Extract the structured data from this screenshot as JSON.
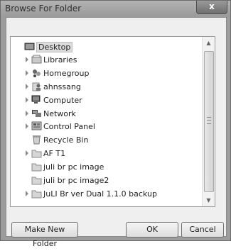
{
  "window": {
    "title": "Browse For Folder",
    "close_glyph": "x"
  },
  "tree": {
    "items": [
      {
        "label": "Desktop",
        "icon": "desktop-icon",
        "selected": true,
        "expander": false
      },
      {
        "label": "Libraries",
        "icon": "libraries-icon",
        "expander": true
      },
      {
        "label": "Homegroup",
        "icon": "homegroup-icon",
        "expander": true
      },
      {
        "label": "ahnssang",
        "icon": "user-folder-icon",
        "expander": true
      },
      {
        "label": "Computer",
        "icon": "computer-icon",
        "expander": true
      },
      {
        "label": "Network",
        "icon": "network-icon",
        "expander": true
      },
      {
        "label": "Control Panel",
        "icon": "control-panel-icon",
        "expander": true
      },
      {
        "label": "Recycle Bin",
        "icon": "recycle-bin-icon",
        "expander": false
      },
      {
        "label": "AF T1",
        "icon": "folder-icon",
        "expander": true
      },
      {
        "label": "juli br pc image",
        "icon": "folder-icon",
        "expander": false
      },
      {
        "label": "juli br pc image2",
        "icon": "folder-icon",
        "expander": false
      },
      {
        "label": "JuLI Br ver Dual 1.1.0 backup",
        "icon": "folder-icon",
        "expander": true
      }
    ]
  },
  "buttons": {
    "new_folder": "Make New Folder",
    "ok": "OK",
    "cancel": "Cancel"
  }
}
